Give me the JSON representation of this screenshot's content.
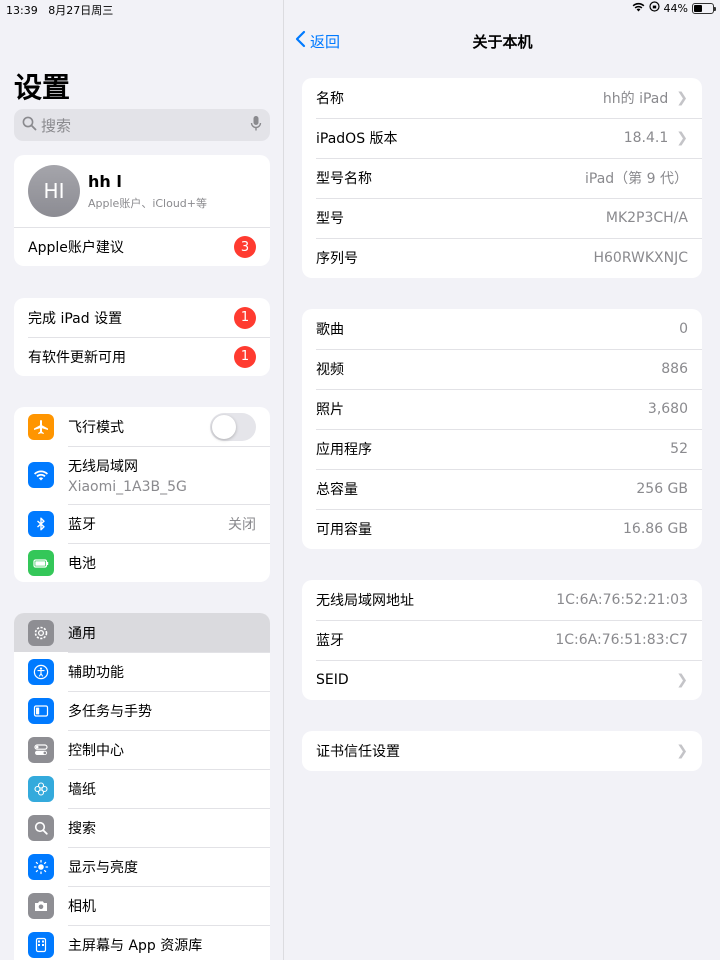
{
  "status": {
    "time": "13:39",
    "date": "8月27日周三",
    "battery": "44%"
  },
  "sidebar": {
    "title": "设置",
    "search_placeholder": "搜索",
    "profile": {
      "initials": "HI",
      "name": "hh l",
      "subtitle": "Apple账户、iCloud+等"
    },
    "account_suggestion": {
      "label": "Apple账户建议",
      "badge": "3"
    },
    "alerts": [
      {
        "label": "完成 iPad 设置",
        "badge": "1"
      },
      {
        "label": "有软件更新可用",
        "badge": "1"
      }
    ],
    "connectivity": {
      "airplane": {
        "label": "飞行模式",
        "on": false
      },
      "wifi": {
        "label": "无线局域网",
        "network": "Xiaomi_1A3B_5G"
      },
      "bluetooth": {
        "label": "蓝牙",
        "value": "关闭"
      },
      "battery": {
        "label": "电池"
      }
    },
    "menu": [
      {
        "label": "通用",
        "icon": "gear-icon",
        "selected": true
      },
      {
        "label": "辅助功能",
        "icon": "accessibility-icon"
      },
      {
        "label": "多任务与手势",
        "icon": "multitasking-icon"
      },
      {
        "label": "控制中心",
        "icon": "control-center-icon"
      },
      {
        "label": "墙纸",
        "icon": "wallpaper-icon"
      },
      {
        "label": "搜索",
        "icon": "search-icon"
      },
      {
        "label": "显示与亮度",
        "icon": "brightness-icon"
      },
      {
        "label": "相机",
        "icon": "camera-icon"
      },
      {
        "label": "主屏幕与 App 资源库",
        "icon": "home-screen-icon"
      }
    ]
  },
  "detail": {
    "back_label": "返回",
    "title": "关于本机",
    "group1": [
      {
        "label": "名称",
        "value": "hh的 iPad",
        "chevron": true
      },
      {
        "label": "iPadOS 版本",
        "value": "18.4.1",
        "chevron": true
      },
      {
        "label": "型号名称",
        "value": "iPad（第 9 代）"
      },
      {
        "label": "型号",
        "value": "MK2P3CH/A"
      },
      {
        "label": "序列号",
        "value": "H60RWKXNJC"
      }
    ],
    "group2": [
      {
        "label": "歌曲",
        "value": "0"
      },
      {
        "label": "视频",
        "value": "886"
      },
      {
        "label": "照片",
        "value": "3,680"
      },
      {
        "label": "应用程序",
        "value": "52"
      },
      {
        "label": "总容量",
        "value": "256 GB"
      },
      {
        "label": "可用容量",
        "value": "16.86 GB"
      }
    ],
    "group3": [
      {
        "label": "无线局域网地址",
        "value": "1C:6A:76:52:21:03"
      },
      {
        "label": "蓝牙",
        "value": "1C:6A:76:51:83:C7"
      },
      {
        "label": "SEID",
        "value": "",
        "chevron": true
      }
    ],
    "group4": [
      {
        "label": "证书信任设置",
        "value": "",
        "chevron": true
      }
    ]
  },
  "colors": {
    "accent": "#007aff",
    "badge": "#ff3b30",
    "airplane": "#ff9500",
    "wifi": "#007aff",
    "bluetooth": "#007aff",
    "battery": "#34c759",
    "general": "#8e8e93"
  }
}
